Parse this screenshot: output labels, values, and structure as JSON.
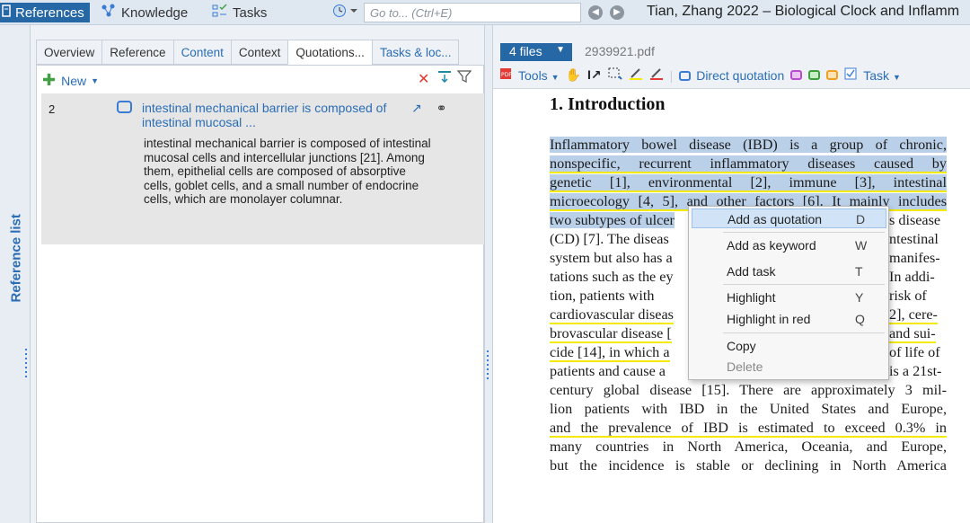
{
  "toolbar": {
    "references_label": "References",
    "knowledge_label": "Knowledge",
    "tasks_label": "Tasks",
    "goto_placeholder": "Go to... (Ctrl+E)",
    "document_title": "Tian, Zhang 2022 – Biological Clock and Inflamm",
    "icons": [
      "references-icon",
      "knowledge-icon",
      "tasks-icon",
      "history-icon",
      "back-icon",
      "forward-icon"
    ]
  },
  "left_strip": {
    "label": "Reference list"
  },
  "tabs": [
    {
      "label": "Overview",
      "active": false,
      "link": false
    },
    {
      "label": "Reference",
      "active": false,
      "link": false
    },
    {
      "label": "Content",
      "active": false,
      "link": true
    },
    {
      "label": "Context",
      "active": false,
      "link": false
    },
    {
      "label": "Quotations...",
      "active": true,
      "link": false
    },
    {
      "label": "Tasks & loc...",
      "active": false,
      "link": true
    }
  ],
  "panel": {
    "new_label": "New",
    "quotation": {
      "number": "2",
      "title": "intestinal mechanical barrier is composed of intestinal  mucosal ...",
      "text": "intestinal mechanical barrier is composed of intestinal mucosal cells and intercellular junctions [21]. Among them, epithelial cells are composed of absorptive cells, goblet cells, and a small number of endocrine cells, which are monolayer columnar."
    }
  },
  "pdf": {
    "files_label": "4 files",
    "file_name": "2939921.pdf",
    "tools_label": "Tools",
    "direct_quotation_label": "Direct quotation",
    "task_label": "Task",
    "heading": "1. Introduction",
    "lines": [
      "Inflammatory bowel disease (IBD) is a group of chronic,",
      "nonspecific, recurrent inflammatory diseases caused by",
      "genetic [1], environmental [2], immune [3], intestinal",
      "microecology [4, 5], and other factors [6]. It mainly includes",
      "two subtypes of ulcer",
      "(CD) [7]. The diseas",
      "system but also has a",
      "tations such as the ey",
      "tion, patients with",
      "cardiovascular diseas",
      "brovascular disease [",
      "cide [14], in which a",
      "patients and cause a",
      "century global disease [15]. There are approximately 3 mil-",
      "lion patients with IBD in the United States and Europe,",
      "and the prevalence of IBD is estimated to exceed 0.3% in",
      "many countries in North America, Oceania, and Europe,",
      "but the incidence is stable or declining in North America"
    ],
    "right_fragments": [
      "s disease",
      "ntestinal",
      "manifes-",
      "In addi-",
      "risk of",
      "2], cere-",
      "and sui-",
      "of life of",
      "is a 21st-"
    ]
  },
  "context_menu": {
    "items": [
      {
        "label": "Add as quotation",
        "key": "D"
      },
      {
        "label": "Add as keyword",
        "key": "W"
      },
      {
        "label": "Add task",
        "key": "T"
      },
      {
        "label": "Highlight",
        "key": "Y"
      },
      {
        "label": "Highlight in red",
        "key": "Q"
      },
      {
        "label": "Copy",
        "key": ""
      },
      {
        "label": "Delete",
        "key": ""
      }
    ]
  },
  "colors": {
    "accent": "#2667a6",
    "link": "#2a6db5",
    "selection": "#bad0e8",
    "highlight_underline": "#f3ea00",
    "menu_hover": "#d1e4f7"
  }
}
